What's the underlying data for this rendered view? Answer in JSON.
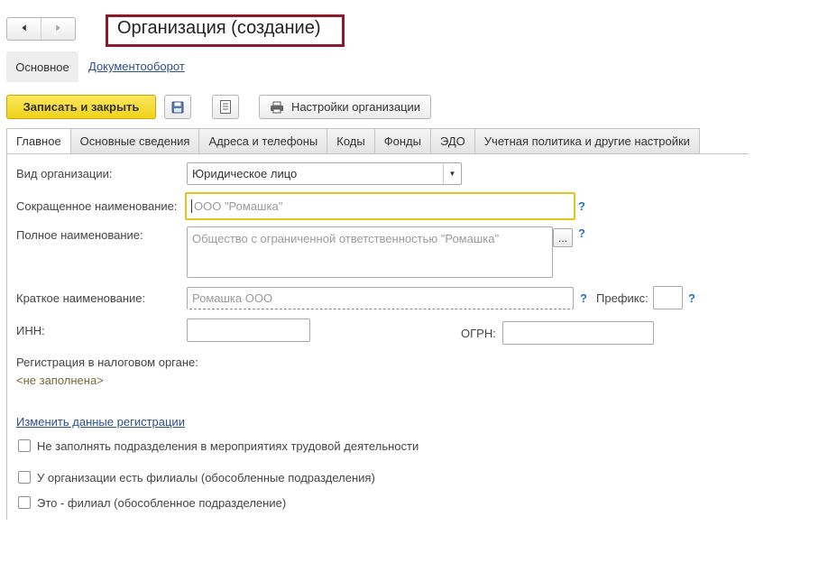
{
  "nav": {
    "back_icon": "arrow-left-icon",
    "forward_icon": "arrow-right-icon"
  },
  "window": {
    "title": "Организация (создание)"
  },
  "sections": {
    "main": "Основное",
    "docflow": "Документооборот"
  },
  "toolbar": {
    "save_close": "Записать и закрыть",
    "save_icon": "floppy-disk-icon",
    "list_icon": "document-list-icon",
    "settings_label": "Настройки организации",
    "settings_icon": "printer-icon"
  },
  "tabs": [
    "Главное",
    "Основные сведения",
    "Адреса и телефоны",
    "Коды",
    "Фонды",
    "ЭДО",
    "Учетная политика и другие настройки"
  ],
  "form": {
    "org_type_label": "Вид организации:",
    "org_type_value": "Юридическое лицо",
    "short_name_label": "Сокращенное наименование:",
    "short_name_placeholder": "ООО \"Ромашка\"",
    "full_name_label": "Полное наименование:",
    "full_name_placeholder": "Общество с ограниченной ответственностью \"Ромашка\"",
    "full_name_button": "...",
    "brief_name_label": "Краткое наименование:",
    "brief_name_placeholder": "Ромашка ООО",
    "prefix_label": "Префикс:",
    "prefix_value": "",
    "inn_label": "ИНН:",
    "inn_value": "",
    "ogrn_label": "ОГРН:",
    "ogrn_value": "",
    "help": "?",
    "tax_reg_label": "Регистрация в налоговом органе:",
    "tax_reg_value": "<не заполнена>",
    "change_reg_link": "Изменить данные регистрации"
  },
  "checkboxes": [
    {
      "label": "Не заполнять подразделения в мероприятиях трудовой деятельности",
      "checked": false
    },
    {
      "label": "У организации есть филиалы (обособленные подразделения)",
      "checked": false
    },
    {
      "label": "Это - филиал (обособленное подразделение)",
      "checked": false
    }
  ],
  "colors": {
    "accent_yellow": "#f1d21c",
    "title_border": "#8b1a2b",
    "link": "#2e4e8f",
    "focus": "#e8c31a"
  }
}
